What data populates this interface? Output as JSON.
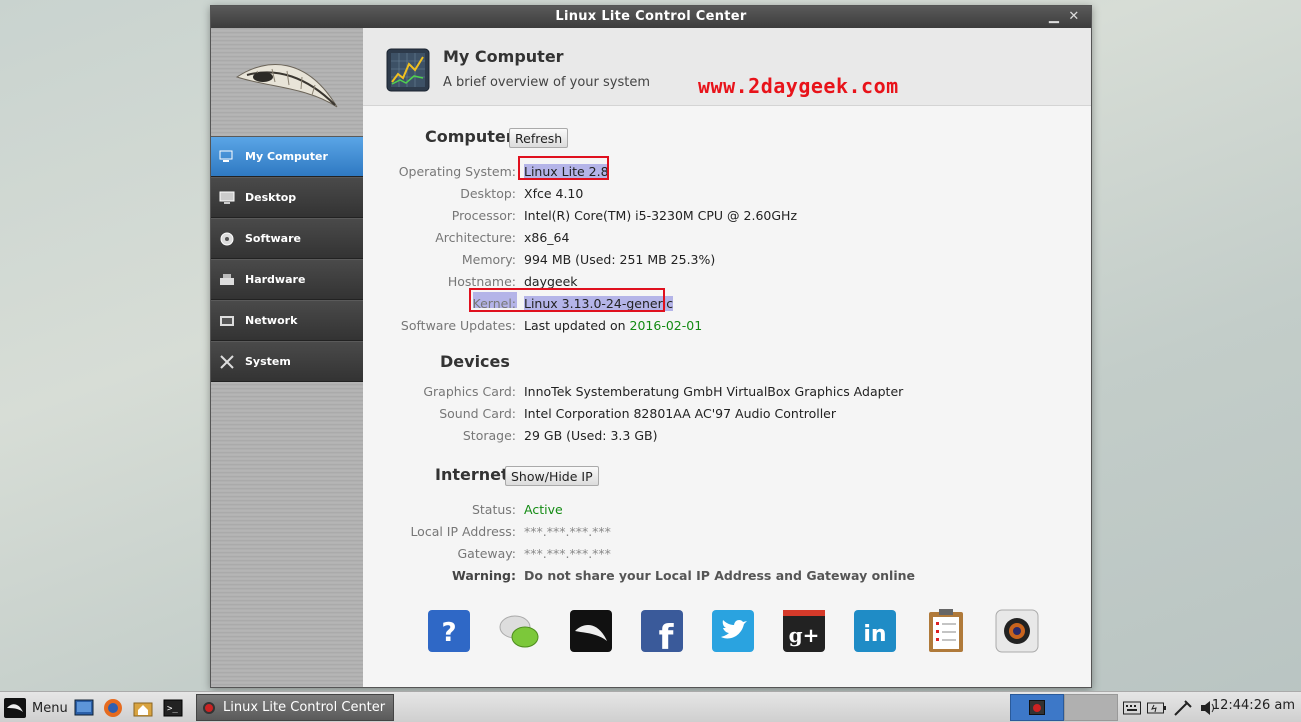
{
  "window": {
    "title": "Linux Lite Control Center",
    "minimize": "▁",
    "close": "✕"
  },
  "sidebar": {
    "items": [
      {
        "label": "My Computer",
        "icon": "monitor-icon",
        "active": true
      },
      {
        "label": "Desktop",
        "icon": "desktop-icon"
      },
      {
        "label": "Software",
        "icon": "software-icon"
      },
      {
        "label": "Hardware",
        "icon": "hardware-icon"
      },
      {
        "label": "Network",
        "icon": "network-icon"
      },
      {
        "label": "System",
        "icon": "tools-icon"
      }
    ]
  },
  "header": {
    "title": "My Computer",
    "subtitle": "A brief overview of your system",
    "watermark": "www.2daygeek.com"
  },
  "computer": {
    "title": "Computer",
    "refresh_label": "Refresh",
    "rows": [
      {
        "label": "Operating System:",
        "value": "Linux Lite 2.8"
      },
      {
        "label": "Desktop:",
        "value": "Xfce 4.10"
      },
      {
        "label": "Processor:",
        "value": "Intel(R) Core(TM) i5-3230M CPU @ 2.60GHz"
      },
      {
        "label": "Architecture:",
        "value": "x86_64"
      },
      {
        "label": "Memory:",
        "value": "994 MB (Used: 251 MB 25.3%)"
      },
      {
        "label": "Hostname:",
        "value": "daygeek"
      },
      {
        "label": "Kernel:",
        "value": "Linux 3.13.0-24-generic"
      },
      {
        "label": "Software Updates:",
        "value": "Last updated on ",
        "date": "2016-02-01"
      }
    ]
  },
  "devices": {
    "title": "Devices",
    "rows": [
      {
        "label": "Graphics Card:",
        "value": "InnoTek Systemberatung GmbH VirtualBox Graphics Adapter"
      },
      {
        "label": "Sound Card:",
        "value": "Intel Corporation 82801AA AC'97 Audio Controller"
      },
      {
        "label": "Storage:",
        "value": "29 GB (Used: 3.3 GB)"
      }
    ]
  },
  "internet": {
    "title": "Internet",
    "toggle_label": "Show/Hide IP",
    "rows": [
      {
        "label": "Status:",
        "value": "Active"
      },
      {
        "label": "Local IP Address:",
        "value": "***.***.***.***"
      },
      {
        "label": "Gateway:",
        "value": "***.***.***.***"
      },
      {
        "label": "Warning:",
        "value": "Do not share your Local IP Address and Gateway online"
      }
    ]
  },
  "social_icons": [
    "help-icon",
    "chat-icon",
    "linux-lite-icon",
    "facebook-icon",
    "twitter-icon",
    "google-plus-icon",
    "linkedin-icon",
    "clipboard-icon",
    "camera-icon"
  ],
  "taskbar": {
    "menu_label": "Menu",
    "task_label": "Linux Lite Control Center",
    "clock": "12:44:26 am"
  },
  "colors": {
    "accent": "#2f79c2",
    "highlight_border": "#e0101e",
    "watermark": "#e8131a",
    "status_green": "#138b13"
  }
}
